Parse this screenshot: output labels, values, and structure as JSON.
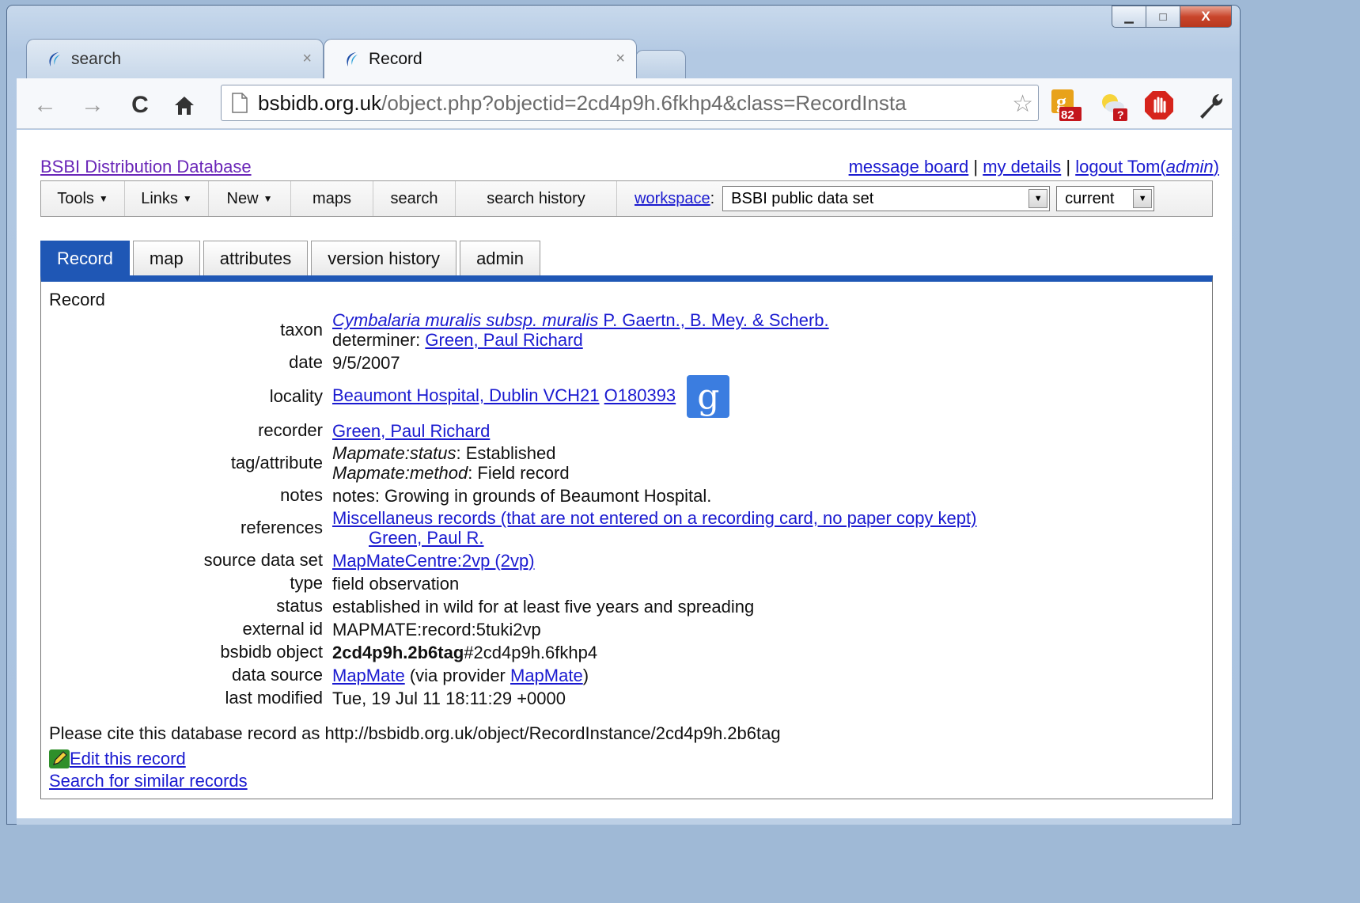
{
  "browser": {
    "tabs": [
      {
        "title": "search",
        "close": "×"
      },
      {
        "title": "Record",
        "close": "×"
      }
    ],
    "address": {
      "host": "bsbidb.org.uk",
      "path": "/object.php?objectid=2cd4p9h.6fkhp4&class=RecordInsta"
    },
    "extensions": [
      {
        "name": "gmail-checker-icon",
        "badge": "82"
      },
      {
        "name": "weather-extension-icon",
        "badge": "?"
      },
      {
        "name": "adblock-icon"
      },
      {
        "name": "wrench-icon"
      }
    ],
    "window_controls": {
      "minimize": "▁",
      "maximize": "□",
      "close": "X"
    }
  },
  "site": {
    "title": "BSBI Distribution Database",
    "top_links": {
      "message_board": "message board",
      "sep1": " | ",
      "my_details": "my details",
      "sep2": " | ",
      "logout": "logout Tom(",
      "admin": "admin",
      "close_paren": ")"
    },
    "menu": {
      "tools": "Tools",
      "links": "Links",
      "new": "New",
      "maps": "maps",
      "search": "search",
      "search_history": "search history",
      "workspace_label": "workspace",
      "workspace_colon": ":",
      "workspace_value": "BSBI public data set",
      "version_value": "current"
    },
    "page_tabs": [
      "Record",
      "map",
      "attributes",
      "version history",
      "admin"
    ]
  },
  "record": {
    "heading": "Record",
    "taxon": {
      "label": "taxon",
      "name": "Cymbalaria muralis subsp. muralis",
      "authority": " P. Gaertn., B. Mey. & Scherb.",
      "determiner_label": "determiner: ",
      "determiner": "Green, Paul Richard"
    },
    "date": {
      "label": "date",
      "value": "9/5/2007"
    },
    "locality": {
      "label": "locality",
      "place": "Beaumont Hospital, Dublin VCH21",
      "gridref": "O180393",
      "google": "g"
    },
    "recorder": {
      "label": "recorder",
      "value": "Green, Paul Richard"
    },
    "tags": {
      "label": "tag/attribute",
      "items": [
        {
          "key": "Mapmate:status",
          "value": ": Established"
        },
        {
          "key": "Mapmate:method",
          "value": ": Field record"
        }
      ]
    },
    "notes": {
      "label": "notes",
      "value": "notes: Growing in grounds of Beaumont Hospital."
    },
    "references": {
      "label": "references",
      "title": "Miscellaneus records (that are not entered on a recording card, no paper copy kept)",
      "author": "Green, Paul R."
    },
    "source_data_set": {
      "label": "source data set",
      "value": "MapMateCentre:2vp (2vp)"
    },
    "type": {
      "label": "type",
      "value": "field observation"
    },
    "status": {
      "label": "status",
      "value": "established in wild for at least five years and spreading"
    },
    "external_id": {
      "label": "external id",
      "value": "MAPMATE:record:5tuki2vp"
    },
    "bsbidb_object": {
      "label": "bsbidb object",
      "bold": "2cd4p9h.2b6tag",
      "rest": "#2cd4p9h.6fkhp4"
    },
    "data_source": {
      "label": "data source",
      "source": "MapMate",
      "via": " (via provider ",
      "provider": "MapMate",
      "end": ")"
    },
    "last_modified": {
      "label": "last modified",
      "value": "Tue, 19 Jul 11 18:11:29 +0000"
    },
    "cite": "Please cite this database record as http://bsbidb.org.uk/object/RecordInstance/2cd4p9h.2b6tag",
    "edit_link": "Edit this record",
    "similar_link": "Search for similar records"
  }
}
